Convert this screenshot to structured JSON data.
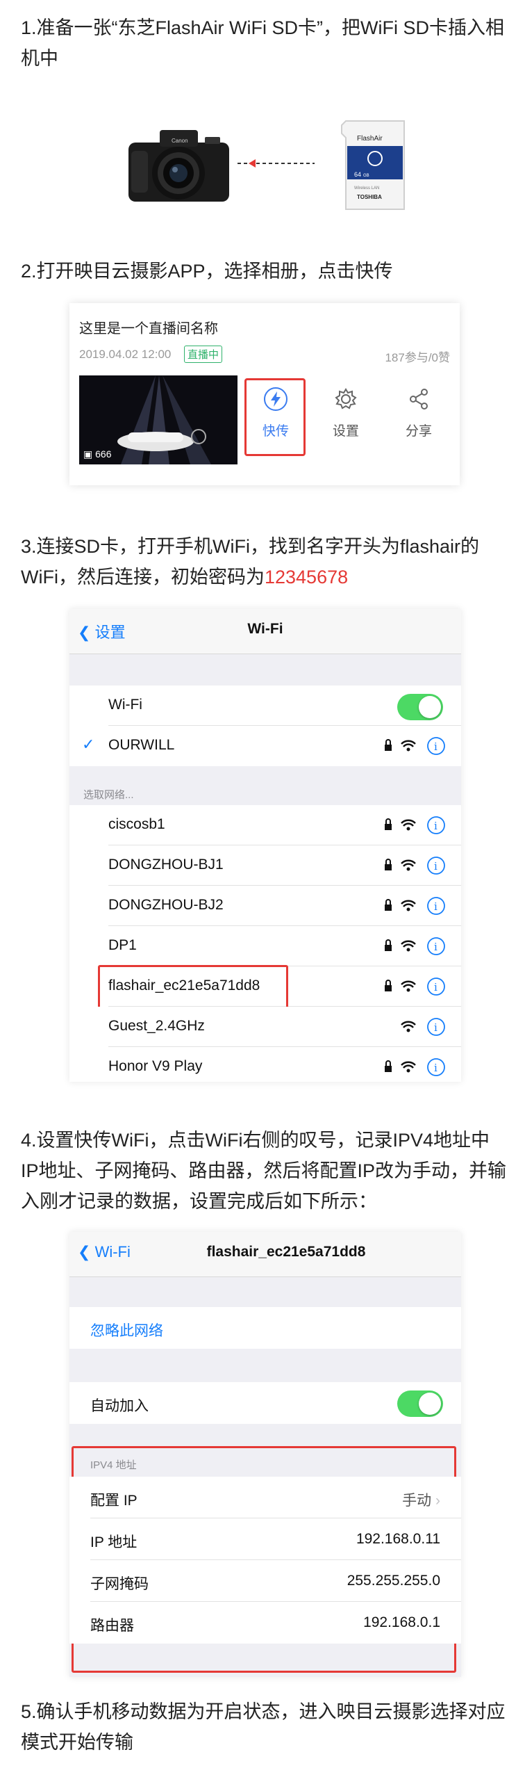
{
  "steps": {
    "s1": "1.准备一张“东芝FlashAir WiFi SD卡”，把WiFi SD卡插入相机中",
    "s2": "2.打开映目云摄影APP，选择相册，点击快传",
    "s3_pre": "3.连接SD卡，打开手机WiFi，找到名字开头为flashair的WiFi，然后连接，初始密码为",
    "s3_pwd": "12345678",
    "s4": "4.设置快传WiFi，点击WiFi右侧的叹号，记录IPV4地址中IP地址、子网掩码、路由器，然后将配置IP改为手动，并输入刚才记录的数据，设置完成后如下所示：",
    "s5": "5.确认手机移动数据为开启状态，进入映目云摄影选择对应模式开始传输"
  },
  "sdcard": {
    "brand": "FlashAir",
    "capacity": "64",
    "unit": "GB",
    "maker": "TOSHIBA",
    "wlan": "Wireless LAN"
  },
  "live_card": {
    "title": "这里是一个直播间名称",
    "date": "2019.04.02 12:00",
    "badge": "直播中",
    "stats": "187参与/0赞",
    "photo_count": "666",
    "actions": {
      "quick": "快传",
      "settings": "设置",
      "share": "分享"
    },
    "accent": "#3b7cf0"
  },
  "wifi_list": {
    "back": "设置",
    "title": "Wi-Fi",
    "wifi_label": "Wi-Fi",
    "connected": "OURWILL",
    "section": "选取网络...",
    "networks": [
      {
        "name": "ciscosb1",
        "locked": true
      },
      {
        "name": "DONGZHOU-BJ1",
        "locked": true
      },
      {
        "name": "DONGZHOU-BJ2",
        "locked": true
      },
      {
        "name": "DP1",
        "locked": true
      },
      {
        "name": "flashair_ec21e5a71dd8",
        "locked": true
      },
      {
        "name": "Guest_2.4GHz",
        "locked": false
      },
      {
        "name": "Honor V9 Play",
        "locked": true
      }
    ],
    "toggle_color": "#4cd964"
  },
  "wifi_detail": {
    "back": "Wi-Fi",
    "title": "flashair_ec21e5a71dd8",
    "forget": "忽略此网络",
    "auto_join": "自动加入",
    "ipv4_header": "IPV4 地址",
    "rows": [
      {
        "label": "配置 IP",
        "value": "手动"
      },
      {
        "label": "IP 地址",
        "value": "192.168.0.11"
      },
      {
        "label": "子网掩码",
        "value": "255.255.255.0"
      },
      {
        "label": "路由器",
        "value": "192.168.0.1"
      }
    ]
  },
  "colors": {
    "highlight": "#e53935",
    "ios_blue": "#157efb"
  }
}
